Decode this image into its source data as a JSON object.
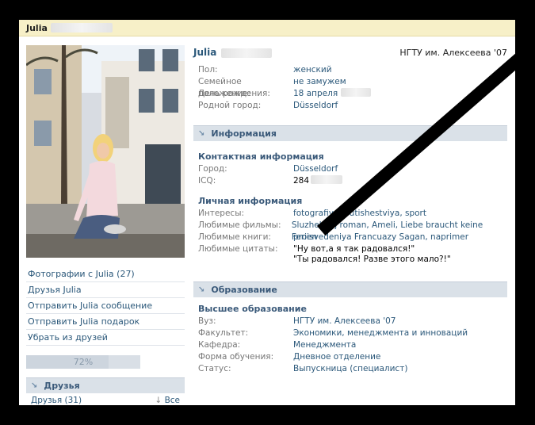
{
  "titlebar": {
    "name": "Julia"
  },
  "left": {
    "menu": [
      "Фотографии с Julia (27)",
      "Друзья Julia",
      "Отправить Julia сообщение",
      "Отправить Julia подарок",
      "Убрать из друзей"
    ],
    "progress": {
      "label": "72%",
      "value": 0.72
    },
    "friends_header": "Друзья",
    "friends_count": "Друзья (31)",
    "friends_all": "Все"
  },
  "profile": {
    "name": "Julia",
    "university": "НГТУ им. Алексеева '07",
    "basic": [
      {
        "k": "Пол:",
        "v": "женский"
      },
      {
        "k": "Семейное положение:",
        "v": "не замужем"
      },
      {
        "k": "День рождения:",
        "v": "18 апреля"
      },
      {
        "k": "Родной город:",
        "v": "Düsseldorf"
      }
    ]
  },
  "info": {
    "header": "Информация",
    "contact_head": "Контактная информация",
    "contact": [
      {
        "k": "Город:",
        "v": "Düsseldorf"
      },
      {
        "k": "ICQ:",
        "v": "284"
      }
    ],
    "personal_head": "Личная информация",
    "personal": [
      {
        "k": "Интересы:",
        "v": "fotografiya, putishestviya, sport"
      },
      {
        "k": "Любимые фильмы:",
        "v": "Sluzhebnyj roman, Ameli, Liebe braucht keine Ferien"
      },
      {
        "k": "Любимые книги:",
        "v": "proisvedeniya Francuazy Sagan, naprimer"
      }
    ],
    "quotes_label": "Любимые цитаты:",
    "quote1": "\"Ну вот,а я так радовался!\"",
    "quote2": "\"Ты радовался! Разве этого мало?!\""
  },
  "education": {
    "header": "Образование",
    "sub": "Высшее образование",
    "rows": [
      {
        "k": "Вуз:",
        "v": "НГТУ им. Алексеева '07"
      },
      {
        "k": "Факультет:",
        "v": "Экономики, менеджмента и инноваций"
      },
      {
        "k": "Кафедра:",
        "v": "Менеджмента"
      },
      {
        "k": "Форма обучения:",
        "v": "Дневное отделение"
      },
      {
        "k": "Статус:",
        "v": "Выпускница (специалист)"
      }
    ]
  }
}
